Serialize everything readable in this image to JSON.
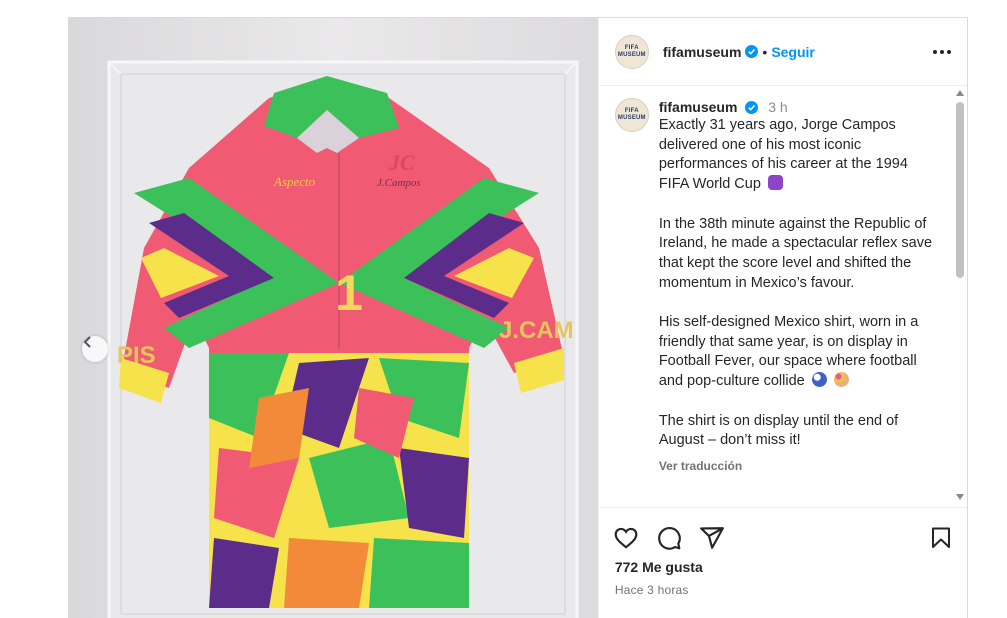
{
  "account": {
    "username": "fifamuseum",
    "avatar_text": "FIFA MUSEUM",
    "follow_label": "Seguir",
    "separator": "•"
  },
  "caption": {
    "time": "3 h",
    "paragraphs": [
      "Exactly 31 years ago, Jorge Campos delivered one of his most iconic performances of his career at the 1994 FIFA World Cup",
      "In the 38th minute against the Republic of Ireland, he made a spectacular reflex save that kept the score level and shifted the momentum in Mexico’s favour.",
      "His self-designed Mexico shirt, worn in a friendly that same year, is on display in Football Fever, our space where football and pop-culture collide",
      "The shirt is on display until the end of August – don’t miss it!"
    ],
    "translate_label": "Ver traducción"
  },
  "shirt": {
    "number": "1",
    "sleeve_left_text": "PIS",
    "sleeve_right_text": "J.CAM",
    "chest_brand": "Aspecto",
    "chest_signature": "J.Campos",
    "chest_logo": "JC"
  },
  "stats": {
    "likes": "772 Me gusta",
    "posted": "Hace 3 horas"
  },
  "icons": [
    "verified-icon",
    "more-options-icon",
    "heart-icon",
    "comment-icon",
    "share-icon",
    "bookmark-icon",
    "chevron-left-icon"
  ],
  "colors": {
    "accent": "#0095f6",
    "shirt_pink": "#f05a73",
    "shirt_green": "#3cc15a",
    "shirt_purple": "#5b2c8a",
    "shirt_yellow": "#f6e24a"
  }
}
